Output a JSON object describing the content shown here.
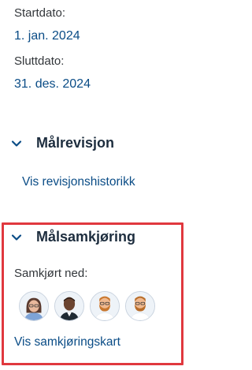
{
  "dates": {
    "start_label": "Startdato:",
    "start_value": "1. jan. 2024",
    "end_label": "Sluttdato:",
    "end_value": "31. des. 2024"
  },
  "revision_section": {
    "title": "Målrevisjon",
    "link": "Vis revisjonshistorikk",
    "chevron_icon": "chevron-down-icon"
  },
  "alignment_section": {
    "title": "Målsamkjøring",
    "chevron_icon": "chevron-down-icon",
    "aligned_label": "Samkjørt ned:",
    "avatars": [
      "avatar-woman-icon",
      "avatar-man-dark-icon",
      "avatar-man-beard-icon",
      "avatar-man-beard-icon"
    ],
    "link": "Vis samkjøringskart",
    "highlight_color": "#e0383e"
  },
  "colors": {
    "link": "#0a4c86",
    "text": "#32363a",
    "title": "#1d2d3e"
  }
}
